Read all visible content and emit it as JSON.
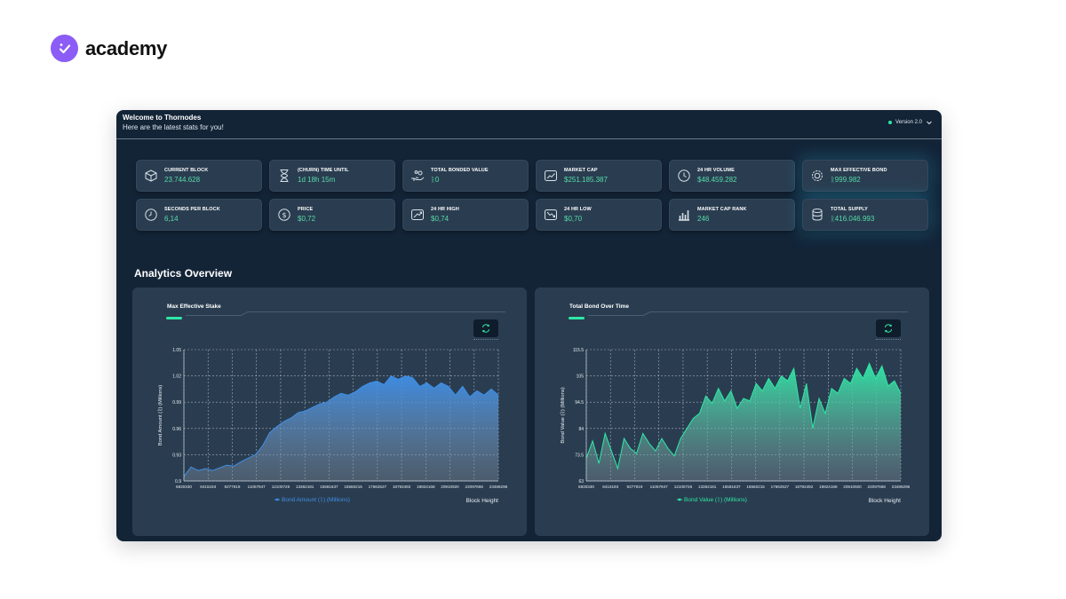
{
  "brand": {
    "name": "academy",
    "icon": "check-badge-icon",
    "color": "#8b5cf6"
  },
  "header": {
    "title": "Welcome to Thornodes",
    "subtitle": "Here are the latest stats for you!",
    "version": "Version 2.0"
  },
  "stats": [
    {
      "label": "CURRENT BLOCK",
      "value": "23.744.628",
      "icon": "cube-icon"
    },
    {
      "label": "(CHURN) TIME UNTIL",
      "value": "1d 18h 15m",
      "icon": "hourglass-icon"
    },
    {
      "label": "TOTAL BONDED VALUE",
      "value": "ᚱ0",
      "icon": "hand-coins-icon"
    },
    {
      "label": "MARKET CAP",
      "value": "$251.185.387",
      "icon": "trend-chart-icon"
    },
    {
      "label": "24 HR VOLUME",
      "value": "$48.459.282",
      "icon": "clock-icon"
    },
    {
      "label": "MAX EFFECTIVE BOND",
      "value": "ᚱ999.982",
      "icon": "gear-coin-icon"
    },
    {
      "label": "SECONDS PER BLOCK",
      "value": "6,14",
      "icon": "timer-icon"
    },
    {
      "label": "PRICE",
      "value": "$0,72",
      "icon": "dollar-coin-icon"
    },
    {
      "label": "24 HR HIGH",
      "value": "$0,74",
      "icon": "trend-up-icon"
    },
    {
      "label": "24 HR LOW",
      "value": "$0,70",
      "icon": "trend-down-icon"
    },
    {
      "label": "MARKET CAP RANK",
      "value": "246",
      "icon": "bar-rank-icon"
    },
    {
      "label": "TOTAL SUPPLY",
      "value": "ᚱ416.046.993",
      "icon": "coin-stack-icon"
    }
  ],
  "analytics": {
    "title": "Analytics Overview"
  },
  "chart_data": [
    {
      "type": "area",
      "title": "Max Effective Stake",
      "ylabel": "Bond Amount (ᚱ) (Millions)",
      "xlabel": "Block Height",
      "legend": "Bond Amount (ᚱ) (Millions)",
      "legend_position": "bottom",
      "grid": true,
      "color": "#3e8fe8",
      "ylim": [
        0.9,
        1.05
      ],
      "yticks": [
        "0.9",
        "0.93",
        "0.96",
        "0.99",
        "1.02",
        "1.05"
      ],
      "xticks": [
        "6830330",
        "8415193",
        "9277919",
        "11057947",
        "12100726",
        "13362181",
        "15581637",
        "16560215",
        "17662527",
        "18792492",
        "19824168",
        "20910920",
        "22097666",
        "23486296"
      ],
      "series": [
        {
          "values": [
            0.905,
            0.916,
            0.912,
            0.914,
            0.912,
            0.915,
            0.918,
            0.917,
            0.922,
            0.926,
            0.93,
            0.94,
            0.955,
            0.962,
            0.968,
            0.972,
            0.978,
            0.98,
            0.984,
            0.988,
            0.99,
            0.996,
            1.0,
            0.998,
            1.002,
            1.008,
            1.012,
            1.014,
            1.01,
            1.02,
            1.016,
            1.02,
            1.018,
            1.008,
            1.012,
            1.006,
            1.012,
            1.008,
            0.998,
            1.008,
            0.996,
            1.003,
            0.998,
            1.005,
            0.998
          ]
        }
      ]
    },
    {
      "type": "area",
      "title": "Total Bond Over Time",
      "ylabel": "Bond Value (ᚱ) (Millions)",
      "xlabel": "Block Height",
      "legend": "Bond Value (ᚱ) (Millions)",
      "legend_position": "bottom",
      "grid": true,
      "color": "#2ee8a6",
      "ylim": [
        63,
        115.5
      ],
      "yticks": [
        "63",
        "73.5",
        "84",
        "94.5",
        "105",
        "115.5"
      ],
      "xticks": [
        "6830330",
        "8415193",
        "9277919",
        "11057947",
        "12100726",
        "13362181",
        "15581637",
        "16560215",
        "17662527",
        "18792492",
        "19824168",
        "20910920",
        "22097666",
        "23486296"
      ],
      "series": [
        {
          "values": [
            72,
            79,
            70,
            82,
            75,
            68,
            80,
            76,
            74,
            82,
            78,
            75,
            80,
            76,
            73,
            80,
            84,
            88,
            90,
            97,
            94,
            100,
            95,
            99,
            92,
            96,
            95,
            102,
            99,
            104,
            100,
            105,
            103,
            108,
            92,
            102,
            84,
            96,
            90,
            100,
            98,
            104,
            102,
            108,
            104,
            110,
            104,
            109,
            101,
            103,
            98
          ]
        }
      ]
    }
  ]
}
